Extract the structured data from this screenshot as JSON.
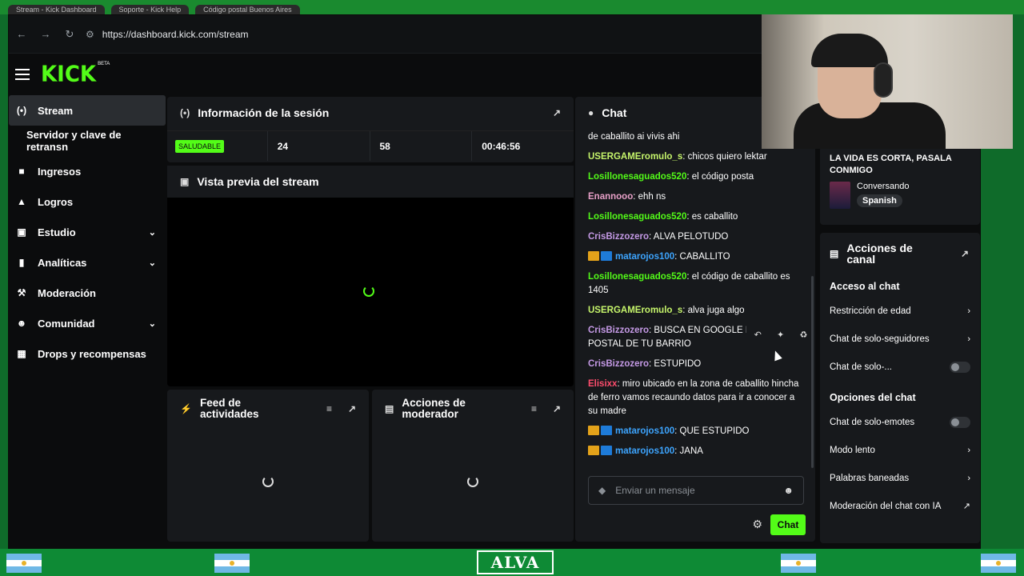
{
  "browser": {
    "tabs": [
      "Stream - Kick Dashboard",
      "Soporte - Kick Help",
      "Código postal Buenos Aires"
    ],
    "url": "https://dashboard.kick.com/stream"
  },
  "brand": {
    "logo": "KICK",
    "beta": "BETA",
    "accent": "#53fc18"
  },
  "sidebar": {
    "items": [
      {
        "label": "Stream",
        "icon": "broadcast-icon"
      },
      {
        "label": "Servidor y clave de retransn"
      },
      {
        "label": "Ingresos",
        "icon": "money-icon"
      },
      {
        "label": "Logros",
        "icon": "trophy-icon"
      },
      {
        "label": "Estudio",
        "icon": "studio-icon"
      },
      {
        "label": "Analíticas",
        "icon": "chart-icon"
      },
      {
        "label": "Moderación",
        "icon": "wrench-icon"
      },
      {
        "label": "Comunidad",
        "icon": "people-icon"
      },
      {
        "label": "Drops y recompensas",
        "icon": "gift-icon"
      }
    ]
  },
  "session": {
    "title": "Información de la sesión",
    "status": "SALUDABLE",
    "stat1": "24",
    "stat2": "58",
    "duration": "00:46:56"
  },
  "preview": {
    "title": "Vista previa del stream"
  },
  "feed": {
    "title_line1": "Feed de",
    "title_line2": "actividades"
  },
  "modactions": {
    "title_line1": "Acciones de",
    "title_line2": "moderador"
  },
  "chat": {
    "title": "Chat",
    "messages": [
      {
        "user": "",
        "text": "de caballito ai vivis ahi",
        "color": "#ffffff"
      },
      {
        "user": "USERGAMEromulo_s",
        "text": ": chicos quiero lektar",
        "color": "#c6f56b"
      },
      {
        "user": "Losillonesaguados520",
        "text": ": el código posta",
        "color": "#53fc18"
      },
      {
        "user": "Enannooo",
        "text": ": ehh ns",
        "color": "#e8a0c8"
      },
      {
        "user": "Losillonesaguados520",
        "text": ": es caballito",
        "color": "#53fc18"
      },
      {
        "user": "CrisBizzozero",
        "text": ": ALVA PELOTUDO",
        "color": "#c59ae6"
      },
      {
        "user": "matarojos100",
        "text": ": CABALLITO",
        "color": "#3da5ff",
        "badges": true
      },
      {
        "user": "Losillonesaguados520",
        "text": ": el código de caballito es 1405",
        "color": "#53fc18"
      },
      {
        "user": "USERGAMEromulo_s",
        "text": ": alva juga algo",
        "color": "#c6f56b"
      },
      {
        "user": "CrisBizzozero",
        "text": ": BUSCA EN GOOGLE EL CODIGO POSTAL DE TU BARRIO",
        "color": "#c59ae6"
      },
      {
        "user": "CrisBizzozero",
        "text": ": ESTUPIDO",
        "color": "#c59ae6"
      },
      {
        "user": "Elisixx",
        "text": ": miro ubicado en la zona de caballito hincha de ferro vamos recaundo datos para ir a conocer a su madre",
        "color": "#ff4d6d"
      },
      {
        "user": "matarojos100",
        "text": ": QUE ESTUPIDO",
        "color": "#3da5ff",
        "badges": true
      },
      {
        "user": "matarojos100",
        "text": ": JANA",
        "color": "#3da5ff",
        "badges": true
      }
    ],
    "input_placeholder": "Enviar un mensaje",
    "send_label": "Chat"
  },
  "stream_info": {
    "title": "LA VIDA ES CORTA, PASALA CONMIGO",
    "category": "Conversando",
    "language": "Spanish"
  },
  "channel_actions": {
    "title_line1": "Acciones de",
    "title_line2": "canal",
    "section_access": "Acceso al chat",
    "age": "Restricción de edad",
    "followers": "Chat de solo-seguidores",
    "subs": "Chat de solo-...",
    "section_options": "Opciones del chat",
    "emotes": "Chat de solo-emotes",
    "slow": "Modo lento",
    "banned": "Palabras baneadas",
    "ai": "Moderación del chat con IA"
  },
  "overlay": {
    "banner": "ALVA"
  }
}
